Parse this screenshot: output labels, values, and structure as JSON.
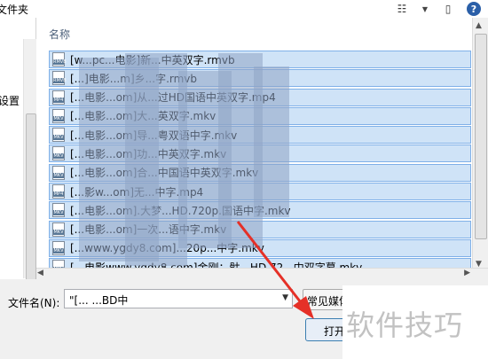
{
  "window": {
    "title": "文件夹"
  },
  "toolbar": {
    "view_icon": "view-details-icon",
    "dropdown_icon": "chevron-down-icon",
    "pane_icon": "preview-pane-icon",
    "help_label": "?"
  },
  "left_nav": {
    "item_label": "设置"
  },
  "list": {
    "column_name": "名称",
    "files": [
      {
        "icon": "RMVB",
        "name": "[w...pc...电影]新...中英双字.rmvb"
      },
      {
        "icon": "RMVB",
        "name": "[...]电影...m]乡...字.rmvb"
      },
      {
        "icon": "MP4",
        "name": "[...电影...om]从...过HD国语中英双字.mp4"
      },
      {
        "icon": "MKV",
        "name": "[...电影...om]大...英双字.mkv"
      },
      {
        "icon": "MKV",
        "name": "[...电影...om]导...粤双语中字.mkv"
      },
      {
        "icon": "MKV",
        "name": "[...电影...om]功...中英双字.mkv"
      },
      {
        "icon": "MKV",
        "name": "[...电影...om]合...中国语中英双字.mkv"
      },
      {
        "icon": "MP4",
        "name": "[...影w...om]无...中字.mp4"
      },
      {
        "icon": "MKV",
        "name": "[...电影...om].大梦...HD.720p.国语中字.mkv"
      },
      {
        "icon": "MKV",
        "name": "[...电影...om]一次...语中字.mkv"
      },
      {
        "icon": "MKV",
        "name": "[...www.ygdy8.com]...20p...中字.mkv"
      },
      {
        "icon": "MKV",
        "name": "[...电影www.ygdy8.com]金刚：骷...HD.72...中双字幕.mkv"
      }
    ]
  },
  "footer": {
    "filename_label": "文件名(N):",
    "filename_value": "\"[...                              ...BD中",
    "filter_label": "常见媒体",
    "open_label": "打开"
  },
  "watermark": "软件技巧",
  "colors": {
    "selection": "#cfe3f7",
    "selection_border": "#7fb0e8",
    "arrow": "#e53027"
  }
}
